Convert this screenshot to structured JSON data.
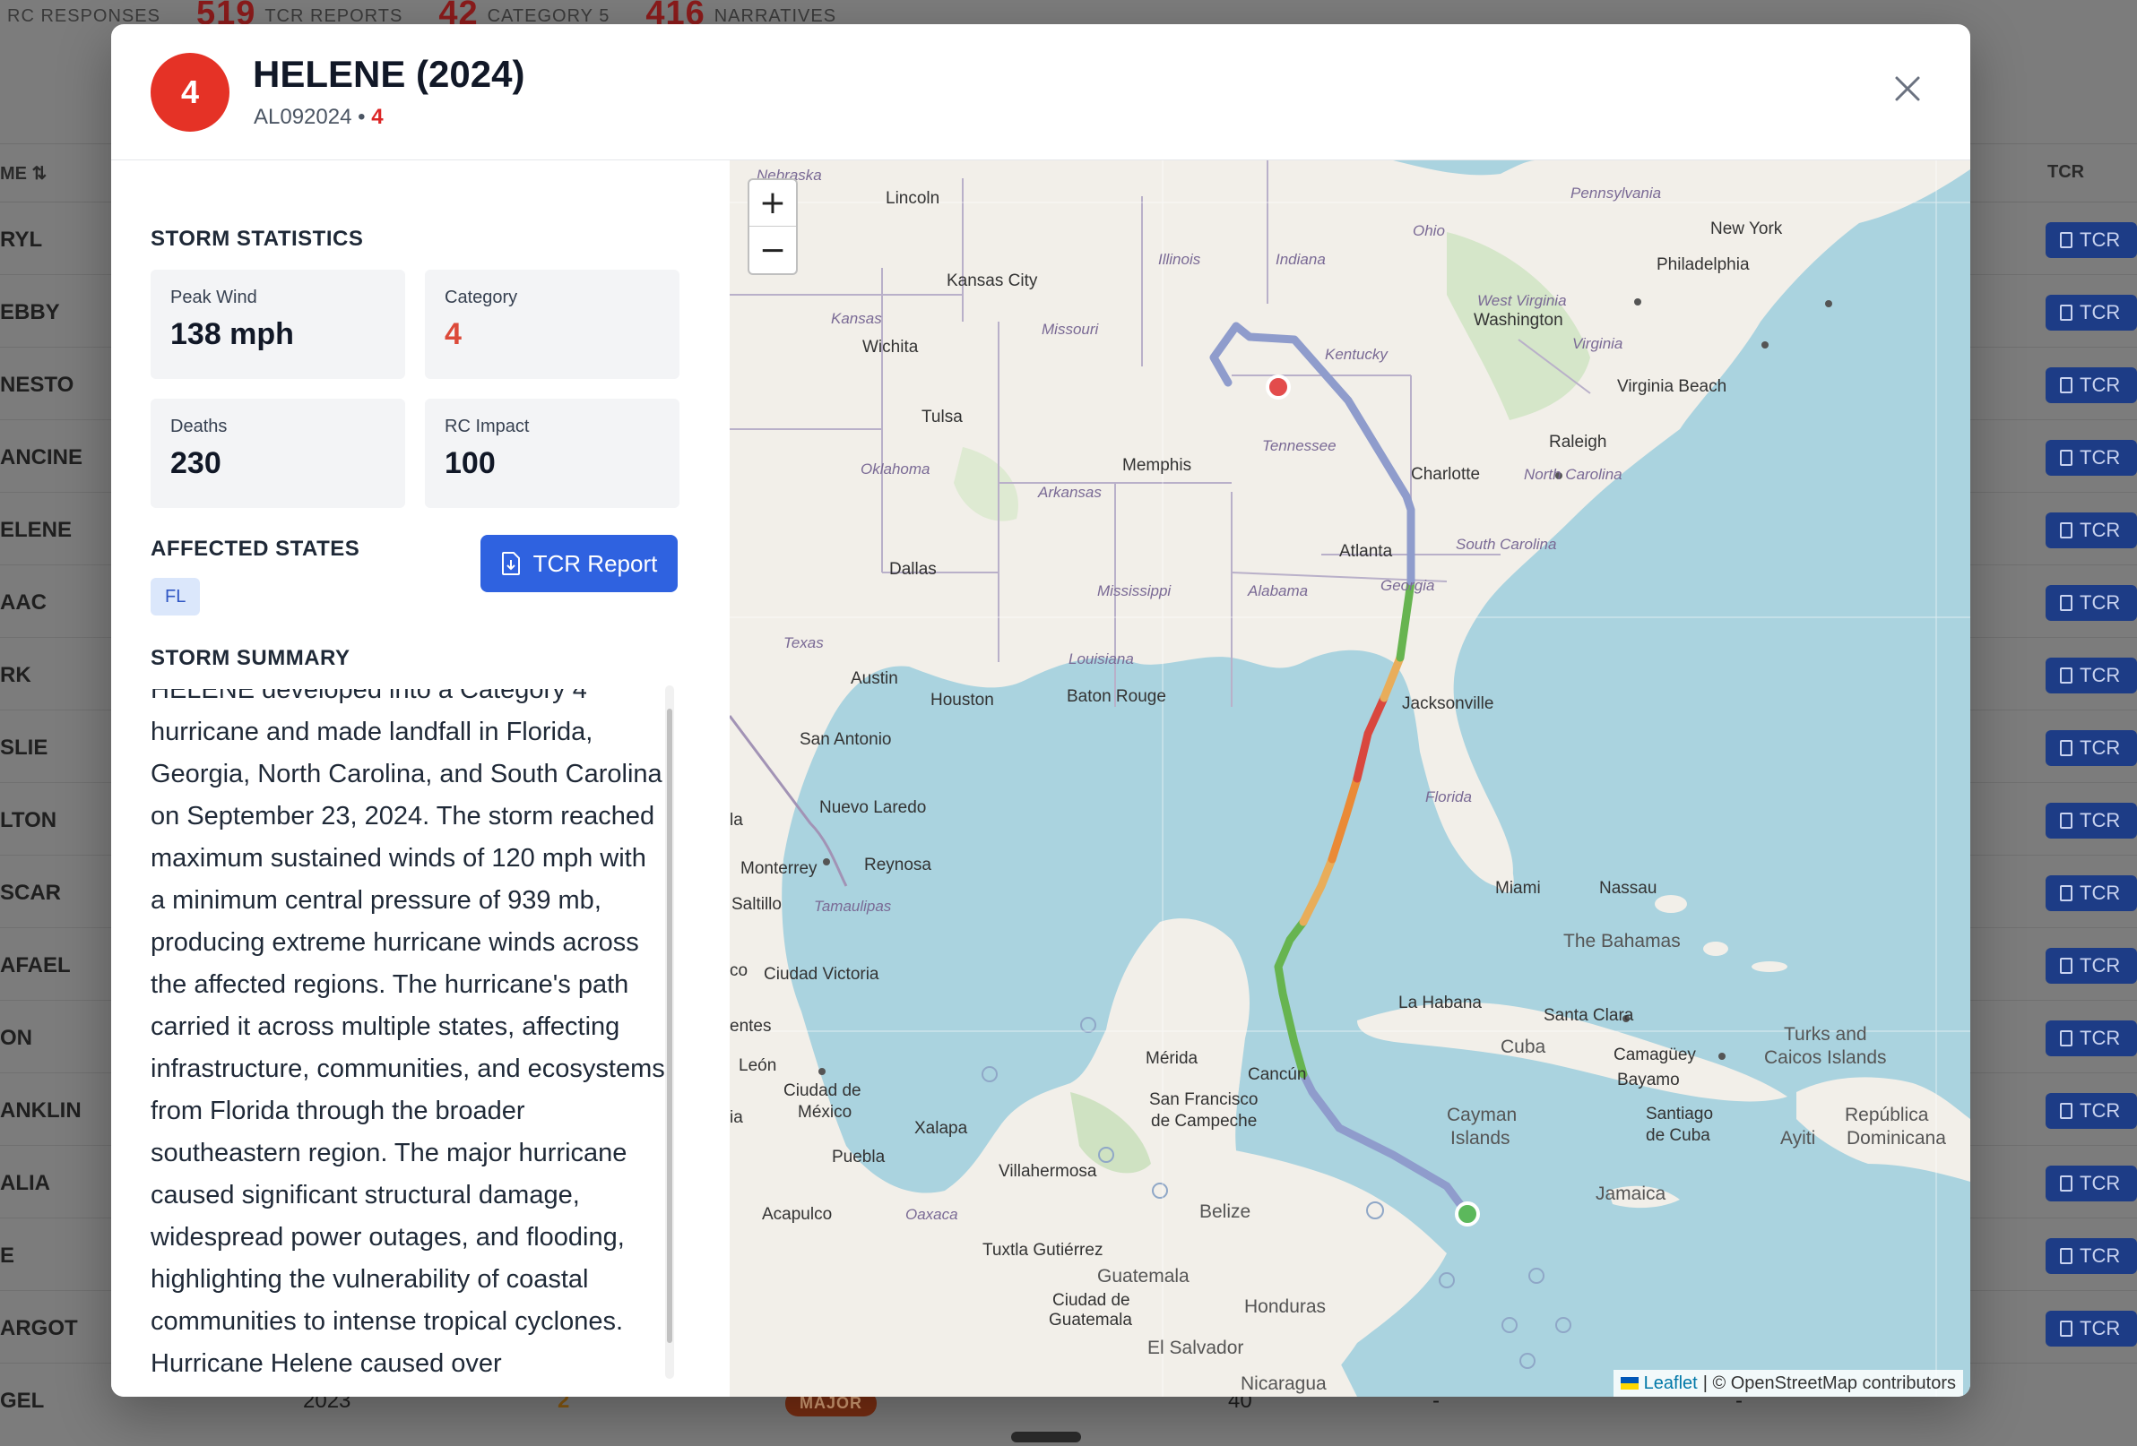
{
  "background": {
    "stats": [
      {
        "num": "",
        "label": "RC RESPONSES"
      },
      {
        "num": "519",
        "label": "TCR REPORTS"
      },
      {
        "num": "42",
        "label": "CATEGORY 5"
      },
      {
        "num": "416",
        "label": "NARRATIVES"
      }
    ],
    "col_name": "ME ⇅",
    "col_tcr": "TCR",
    "rows": [
      "RYL",
      "EBBY",
      "NESTO",
      "ANCINE",
      "ELENE",
      "AAC",
      "RK",
      "SLIE",
      "LTON",
      "SCAR",
      "AFAEL",
      "ON",
      "ANKLIN",
      "ALIA",
      "E",
      "ARGOT"
    ],
    "tcr_label": "TCR",
    "last_row": {
      "name": "GEL",
      "year": "2023",
      "category": "2",
      "badge": "MAJOR",
      "value": "40",
      "dash1": "-",
      "dash2": "-"
    }
  },
  "modal": {
    "category_badge": "4",
    "title": "HELENE (2024)",
    "storm_id": "AL092024",
    "separator": "•",
    "category": "4",
    "close_icon": "close-icon"
  },
  "stats": {
    "section_title": "STORM STATISTICS",
    "peak_wind_label": "Peak Wind",
    "peak_wind_value": "138 mph",
    "category_label": "Category",
    "category_value": "4",
    "deaths_label": "Deaths",
    "deaths_value": "230",
    "rc_impact_label": "RC Impact",
    "rc_impact_value": "100"
  },
  "affected": {
    "section_title": "AFFECTED STATES",
    "states": [
      "FL"
    ],
    "tcr_button": "TCR Report"
  },
  "summary": {
    "section_title": "STORM SUMMARY",
    "text": "HELENE developed into a Category 4 hurricane and made landfall in Florida, Georgia, North Carolina, and South Carolina on September 23, 2024. The storm reached maximum sustained winds of 120 mph with a minimum central pressure of 939 mb, producing extreme hurricane winds across the affected regions. The hurricane's path carried it across multiple states, affecting infrastructure, communities, and ecosystems from Florida through the broader southeastern region. The major hurricane caused significant structural damage, widespread power outages, and flooding, highlighting the vulnerability of coastal communities to intense tropical cyclones. Hurricane Helene caused over"
  },
  "map": {
    "zoom_in": "+",
    "zoom_out": "−",
    "attribution_link": "Leaflet",
    "attribution_text": "| © OpenStreetMap contributors",
    "labels": {
      "nebraska": "Nebraska",
      "pennsylvania": "Pennsylvania",
      "lincoln": "Lincoln",
      "ohio": "Ohio",
      "new_york": "New York",
      "philadelphia": "Philadelphia",
      "illinois": "Illinois",
      "indiana": "Indiana",
      "kansas_city": "Kansas City",
      "kansas": "Kansas",
      "missouri": "Missouri",
      "west_virginia": "West Virginia",
      "washington": "Washington",
      "virginia": "Virginia",
      "wichita": "Wichita",
      "kentucky": "Kentucky",
      "virginia_beach": "Virginia Beach",
      "tulsa": "Tulsa",
      "tennessee": "Tennessee",
      "raleigh": "Raleigh",
      "oklahoma": "Oklahoma",
      "memphis": "Memphis",
      "charlotte": "Charlotte",
      "north_carolina": "North Carolina",
      "arkansas": "Arkansas",
      "atlanta": "Atlanta",
      "south_carolina": "South Carolina",
      "dallas": "Dallas",
      "mississippi": "Mississippi",
      "alabama": "Alabama",
      "georgia": "Georgia",
      "texas": "Texas",
      "louisiana": "Louisiana",
      "austin": "Austin",
      "houston": "Houston",
      "baton_rouge": "Baton Rouge",
      "jacksonville": "Jacksonville",
      "san_antonio": "San Antonio",
      "florida": "Florida",
      "nuevo_laredo": "Nuevo Laredo",
      "monterrey": "Monterrey",
      "reynosa": "Reynosa",
      "saltillo": "Saltillo",
      "tamaulipas": "Tamaulipas",
      "miami": "Miami",
      "nassau": "Nassau",
      "bahamas": "The Bahamas",
      "ciudad_victoria": "Ciudad Victoria",
      "la_habana": "La Habana",
      "santa_clara": "Santa Clara",
      "cuba": "Cuba",
      "turks1": "Turks and",
      "turks2": "Caicos Islands",
      "leon": "León",
      "merida": "Mérida",
      "camaguey": "Camagüey",
      "bayamo": "Bayamo",
      "cancun": "Cancún",
      "cdmx1": "Ciudad de",
      "cdmx2": "México",
      "sf_campeche1": "San Francisco",
      "sf_campeche2": "de Campeche",
      "cayman1": "Cayman",
      "cayman2": "Islands",
      "santiago1": "Santiago",
      "santiago2": "de Cuba",
      "rep_dom1": "República",
      "rep_dom2": "Dominicana",
      "ayiti": "Ayiti",
      "xalapa": "Xalapa",
      "puebla": "Puebla",
      "villahermosa": "Villahermosa",
      "oaxaca": "Oaxaca",
      "jamaica": "Jamaica",
      "acapulco": "Acapulco",
      "belize": "Belize",
      "tuxtla": "Tuxtla Gutiérrez",
      "guatemala": "Guatemala",
      "guatemala_city1": "Ciudad de",
      "guatemala_city2": "Guatemala",
      "honduras": "Honduras",
      "el_salvador": "El Salvador",
      "nicaragua": "Nicaragua",
      "entes": "entes",
      "la": "la",
      "co": "co",
      "ia": "ia"
    }
  },
  "colors": {
    "category_red": "#e53226",
    "primary_blue": "#2f62e0",
    "track_td": "#8f9ccc",
    "track_ts": "#67b450",
    "track_cat1": "#e8ad5a",
    "track_cat2": "#ea8a36",
    "track_cat4": "#d9473e",
    "start_marker": "#5cb85c",
    "end_marker": "#e34c4c"
  }
}
